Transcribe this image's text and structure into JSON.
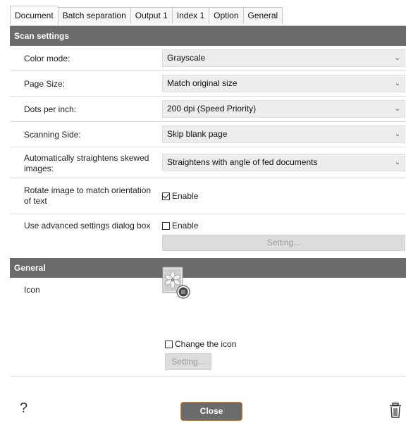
{
  "tabs": [
    "Document",
    "Batch separation",
    "Output 1",
    "Index 1",
    "Option",
    "General"
  ],
  "scan_settings": {
    "header": "Scan settings",
    "color_mode": {
      "label": "Color mode:",
      "value": "Grayscale"
    },
    "page_size": {
      "label": "Page Size:",
      "value": "Match original size"
    },
    "dpi": {
      "label": "Dots per inch:",
      "value": "200 dpi (Speed Priority)"
    },
    "scanning_side": {
      "label": "Scanning Side:",
      "value": "Skip blank page"
    },
    "straighten": {
      "label": "Automatically straightens skewed images:",
      "value": "Straightens with angle of fed documents"
    },
    "rotate": {
      "label": "Rotate image to match orientation of text",
      "checkbox_label": "Enable",
      "checked": true
    },
    "advanced": {
      "label": "Use advanced settings dialog box",
      "checkbox_label": "Enable",
      "checked": false,
      "setting_button": "Setting..."
    }
  },
  "general": {
    "header": "General",
    "icon_label": "Icon",
    "change_icon_label": "Change the icon",
    "change_icon_checked": false,
    "setting_button": "Setting..."
  },
  "footer": {
    "help": "?",
    "close": "Close",
    "trash_icon": "trash-icon"
  },
  "colors": {
    "header_bg": "#6b6b6b",
    "close_border": "#e07a1f",
    "dropdown_bg": "#ececec"
  }
}
